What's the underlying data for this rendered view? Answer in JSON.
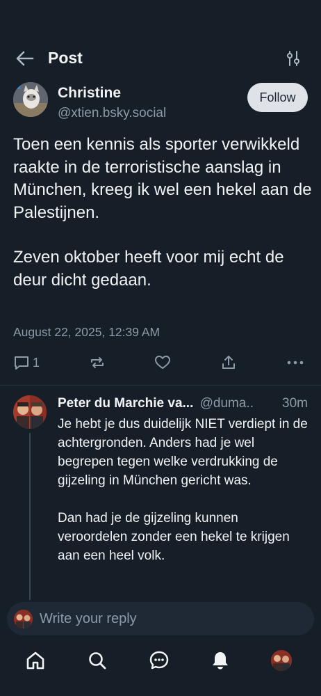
{
  "header": {
    "title": "Post",
    "back_icon": "arrow-left-icon",
    "filter_icon": "sliders-icon"
  },
  "post": {
    "author_name": "Christine",
    "author_handle": "@xtien.bsky.social",
    "follow_label": "Follow",
    "paragraphs": [
      "Toen een kennis als sporter verwikkeld raakte in de terroristische aanslag in München, kreeg ik wel een hekel aan de Palestijnen.",
      "Zeven oktober heeft voor mij echt de deur dicht gedaan."
    ],
    "timestamp": "August 22, 2025, 12:39 AM",
    "reply_count": "1"
  },
  "reply": {
    "author_name": "Peter du Marchie va...",
    "author_handle": "@duma..",
    "time": "30m",
    "paragraphs": [
      "Je hebt je dus duidelijk NIET verdiept in de achtergronden. Anders had je wel begrepen tegen welke verdrukking de gijzeling in München gericht was.",
      "Dan had je de gijzeling kunnen veroordelen zonder een hekel te krijgen aan een heel volk."
    ]
  },
  "composer": {
    "placeholder": "Write your reply"
  },
  "nav": [
    "home-icon",
    "search-icon",
    "chat-icon",
    "bell-icon",
    "profile-avatar"
  ],
  "colors": {
    "background": "#161e27",
    "muted": "#8d9aa9",
    "follow_bg": "#dfe3e8"
  }
}
